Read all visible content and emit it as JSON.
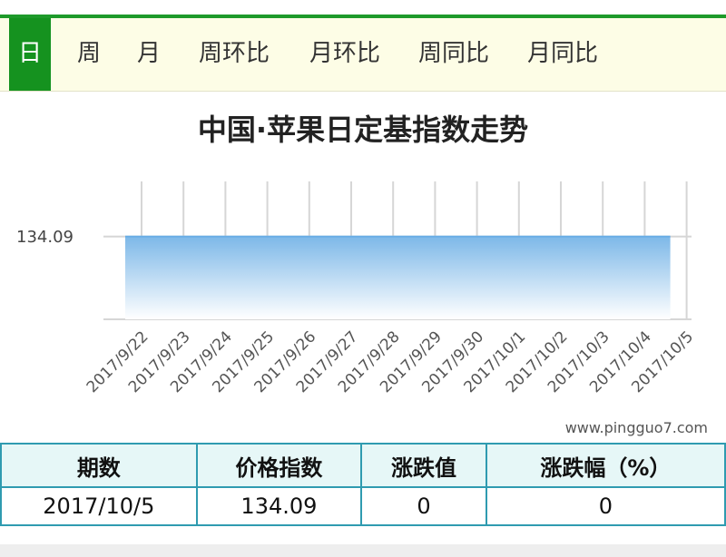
{
  "tabs": [
    {
      "label": "日",
      "active": true
    },
    {
      "label": "周",
      "active": false
    },
    {
      "label": "月",
      "active": false
    },
    {
      "label": "周环比",
      "active": false
    },
    {
      "label": "月环比",
      "active": false
    },
    {
      "label": "周同比",
      "active": false
    },
    {
      "label": "月同比",
      "active": false
    }
  ],
  "watermark": "www.pingguo7.com",
  "colors": {
    "accent": "#15921f",
    "table_border": "#2f9bb0",
    "area_top": "#7db8e8"
  },
  "chart_data": {
    "type": "area",
    "title": "中国·苹果日定基指数走势",
    "xlabel": "",
    "ylabel": "",
    "categories": [
      "2017/9/22",
      "2017/9/23",
      "2017/9/24",
      "2017/9/25",
      "2017/9/26",
      "2017/9/27",
      "2017/9/28",
      "2017/9/29",
      "2017/9/30",
      "2017/10/1",
      "2017/10/2",
      "2017/10/3",
      "2017/10/4",
      "2017/10/5"
    ],
    "series": [
      {
        "values": [
          134.09,
          134.09,
          134.09,
          134.09,
          134.09,
          134.09,
          134.09,
          134.09,
          134.09,
          134.09,
          134.09,
          134.09,
          134.09,
          134.09
        ]
      }
    ],
    "y_tick_labels": [
      "134.09"
    ],
    "grid": true,
    "legend": "none"
  },
  "table": {
    "headers": [
      "期数",
      "价格指数",
      "涨跌值",
      "涨跌幅（%）"
    ],
    "rows": [
      [
        "2017/10/5",
        "134.09",
        "0",
        "0"
      ]
    ]
  }
}
